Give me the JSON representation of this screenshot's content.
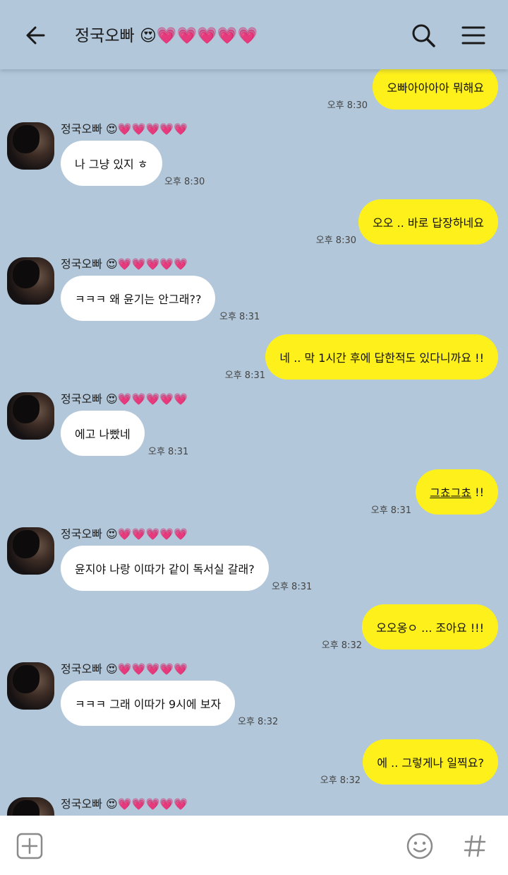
{
  "header": {
    "title": "정국오빠 😍💗💗💗💗💗"
  },
  "contact": {
    "name": "정국오빠 😍💗💗💗💗💗"
  },
  "messages": [
    {
      "dir": "out",
      "text": "오빠아아아아 뭐해요",
      "time": "오후 8:30"
    },
    {
      "dir": "in",
      "text": "나 그냥 있지 ㅎ",
      "time": "오후 8:30"
    },
    {
      "dir": "out",
      "text": "오오 .. 바로 답장하네요",
      "time": "오후 8:30"
    },
    {
      "dir": "in",
      "text": "ㅋㅋㅋ 왜 윤기는 안그래??",
      "time": "오후 8:31"
    },
    {
      "dir": "out",
      "text": "네 .. 막 1시간 후에 답한적도 있다니까요 !!",
      "time": "오후 8:31"
    },
    {
      "dir": "in",
      "text": "에고 나빴네",
      "time": "오후 8:31"
    },
    {
      "dir": "out",
      "text_underlined": "그쵸그쵸",
      "text_rest": " !!",
      "time": "오후 8:31"
    },
    {
      "dir": "in",
      "text": "윤지야 나랑 이따가 같이 독서실 갈래?",
      "time": "오후 8:31"
    },
    {
      "dir": "out",
      "text": "오오옹ㅇ ... 조아요 !!!",
      "time": "오후 8:32"
    },
    {
      "dir": "in",
      "text": "ㅋㅋㅋ 그래 이따가 9시에 보자",
      "time": "오후 8:32"
    },
    {
      "dir": "out",
      "text": "에 .. 그렇게나 일찍요?",
      "time": "오후 8:32"
    }
  ],
  "icons": {
    "back": "arrow-left-icon",
    "search": "search-icon",
    "menu": "menu-icon",
    "attach": "plus-square-icon",
    "emoji": "smiley-icon",
    "hashtag": "hash-icon"
  },
  "colors": {
    "background": "#b2c7da",
    "outgoing_bubble": "#fef01b",
    "incoming_bubble": "#ffffff"
  }
}
